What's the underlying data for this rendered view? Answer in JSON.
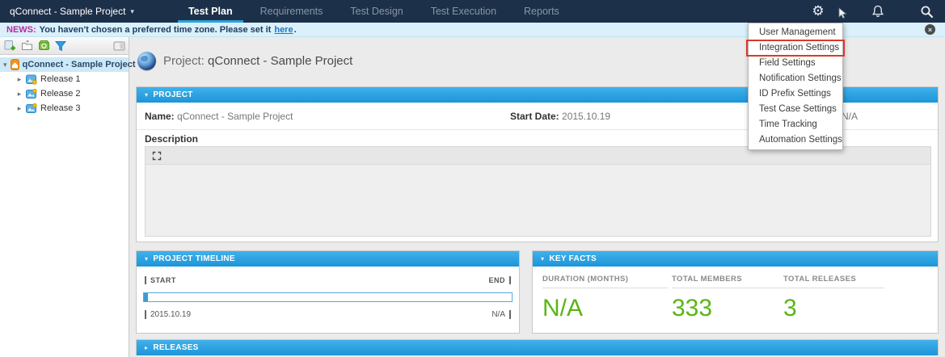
{
  "nav": {
    "project_selector": "qConnect - Sample Project",
    "tabs": [
      {
        "label": "Test Plan",
        "active": true
      },
      {
        "label": "Requirements",
        "active": false
      },
      {
        "label": "Test Design",
        "active": false
      },
      {
        "label": "Test Execution",
        "active": false
      },
      {
        "label": "Reports",
        "active": false
      }
    ]
  },
  "icons": {
    "caret_down": "▾",
    "caret_right": "▸",
    "gear": "⚙",
    "close": "×"
  },
  "news_bar": {
    "prefix": "NEWS:",
    "message": "You haven't chosen a preferred time zone. Please set it",
    "link": "here",
    "suffix": "."
  },
  "sidebar": {
    "tree": {
      "root": "qConnect - Sample Project",
      "items": [
        "Release 1",
        "Release 2",
        "Release 3"
      ]
    }
  },
  "main": {
    "page_title_prefix": "Project:",
    "page_title": "qConnect - Sample Project"
  },
  "project_panel": {
    "title": "PROJECT",
    "fields": [
      {
        "label": "Name:",
        "value": "qConnect - Sample Project"
      },
      {
        "label": "Start Date:",
        "value": "2015.10.19"
      },
      {
        "label": "",
        "value": "N/A"
      }
    ],
    "description_label": "Description"
  },
  "timeline_panel": {
    "title": "PROJECT TIMELINE",
    "start_label": "START",
    "end_label": "END",
    "start_value": "2015.10.19",
    "end_value": "N/A",
    "progress_percent": 1
  },
  "key_facts_panel": {
    "title": "KEY FACTS",
    "facts": [
      {
        "label": "DURATION (MONTHS)",
        "value": "N/A"
      },
      {
        "label": "TOTAL MEMBERS",
        "value": "333"
      },
      {
        "label": "TOTAL RELEASES",
        "value": "3"
      }
    ]
  },
  "releases_panel": {
    "title": "RELEASES"
  },
  "settings_menu": {
    "items": [
      "User Management",
      "Integration Settings",
      "Field Settings",
      "Notification Settings",
      "ID Prefix Settings",
      "Test Case Settings",
      "Time Tracking",
      "Automation Settings"
    ],
    "highlighted_item": "Integration Settings",
    "highlight_color": "#d93a2b"
  },
  "colors": {
    "nav_dark": "#1d3049",
    "panel_header_blue": "#219ce0",
    "value_green": "#5ab515",
    "news_magenta": "#b82aa0",
    "link_blue": "#1f78c1",
    "active_tab_underline": "#2ba0dd"
  }
}
